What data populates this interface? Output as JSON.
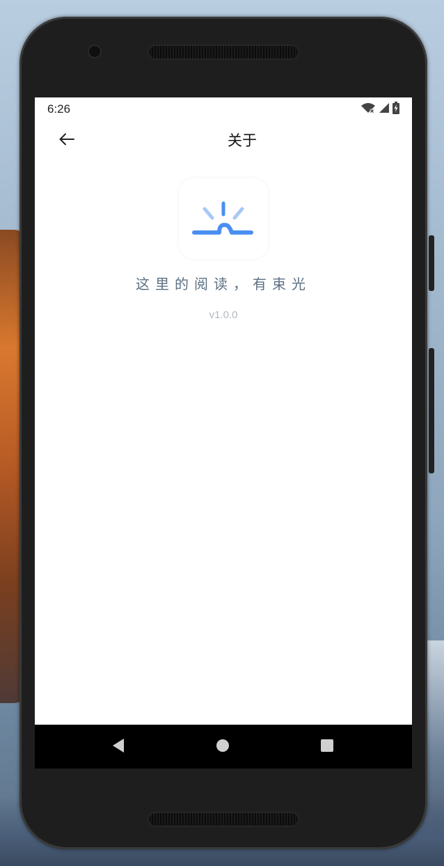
{
  "status_bar": {
    "time": "6:26",
    "icons": [
      "wifi-icon",
      "cell-signal-icon",
      "battery-icon"
    ]
  },
  "app_bar": {
    "back_icon": "arrow-left-icon",
    "title": "关于"
  },
  "about": {
    "logo_icon": "sunrise-logo-icon",
    "tagline": "这里的阅读，有束光",
    "version": "v1.0.0"
  },
  "nav_bar": {
    "buttons": [
      "back-triangle-icon",
      "home-circle-icon",
      "recents-square-icon"
    ]
  },
  "colors": {
    "accent": "#4a8ff0",
    "accent_light": "#a9c8f6",
    "tagline": "#5c6f82",
    "version": "#b4b9bf"
  }
}
